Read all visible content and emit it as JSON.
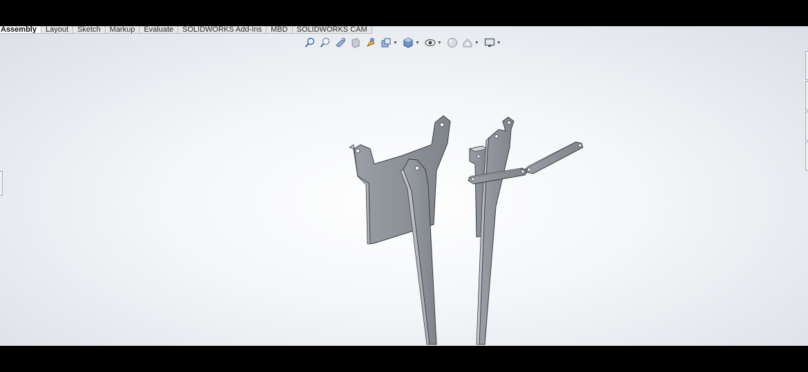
{
  "command_manager": {
    "tabs": [
      {
        "label": "Assembly",
        "active": true
      },
      {
        "label": "Layout",
        "active": false
      },
      {
        "label": "Sketch",
        "active": false
      },
      {
        "label": "Markup",
        "active": false
      },
      {
        "label": "Evaluate",
        "active": false
      },
      {
        "label": "SOLIDWORKS Add-Ins",
        "active": false
      },
      {
        "label": "MBD",
        "active": false
      },
      {
        "label": "SOLIDWORKS CAM",
        "active": false
      }
    ]
  },
  "heads_up_toolbar": {
    "icons": [
      "zoom-to-fit-icon",
      "zoom-to-area-icon",
      "previous-view-icon",
      "section-view-icon",
      "dynamic-annotation-views-icon",
      "view-orientation-icon",
      "display-style-icon",
      "hide-show-items-icon",
      "edit-appearance-icon",
      "apply-scene-icon",
      "view-settings-icon"
    ]
  },
  "colors": {
    "part_face": "#8f939a",
    "part_edge": "#3a3c40",
    "part_highlight": "#c5c8cd",
    "background_center": "#ffffff",
    "background_edge": "#dcdfe5"
  }
}
